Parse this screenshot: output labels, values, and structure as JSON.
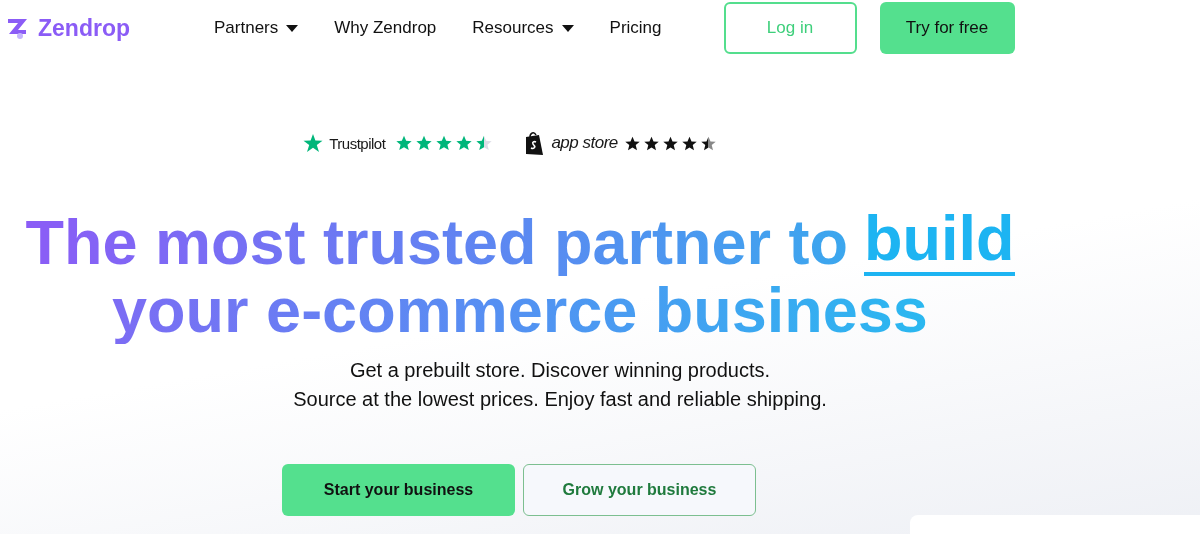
{
  "nav": {
    "logo": "Zendrop",
    "links": [
      {
        "label": "Partners",
        "dropdown": true
      },
      {
        "label": "Why Zendrop",
        "dropdown": false
      },
      {
        "label": "Resources",
        "dropdown": true
      },
      {
        "label": "Pricing",
        "dropdown": false
      }
    ],
    "login": "Log in",
    "cta": "Try for free"
  },
  "ratings": [
    {
      "kind": "trustpilot",
      "label": "Trustpilot",
      "stars": 4.5
    },
    {
      "kind": "appstore",
      "label": "app store",
      "stars": 4.5
    }
  ],
  "hero": {
    "line1": "The most trusted partner to",
    "highlight": "build",
    "line2": "your e-commerce business",
    "sub1": "Get a prebuilt store. Discover winning products.",
    "sub2": "Source at the lowest prices. Enjoy fast and reliable shipping.",
    "primary": "Start your business",
    "secondary": "Grow your business"
  }
}
